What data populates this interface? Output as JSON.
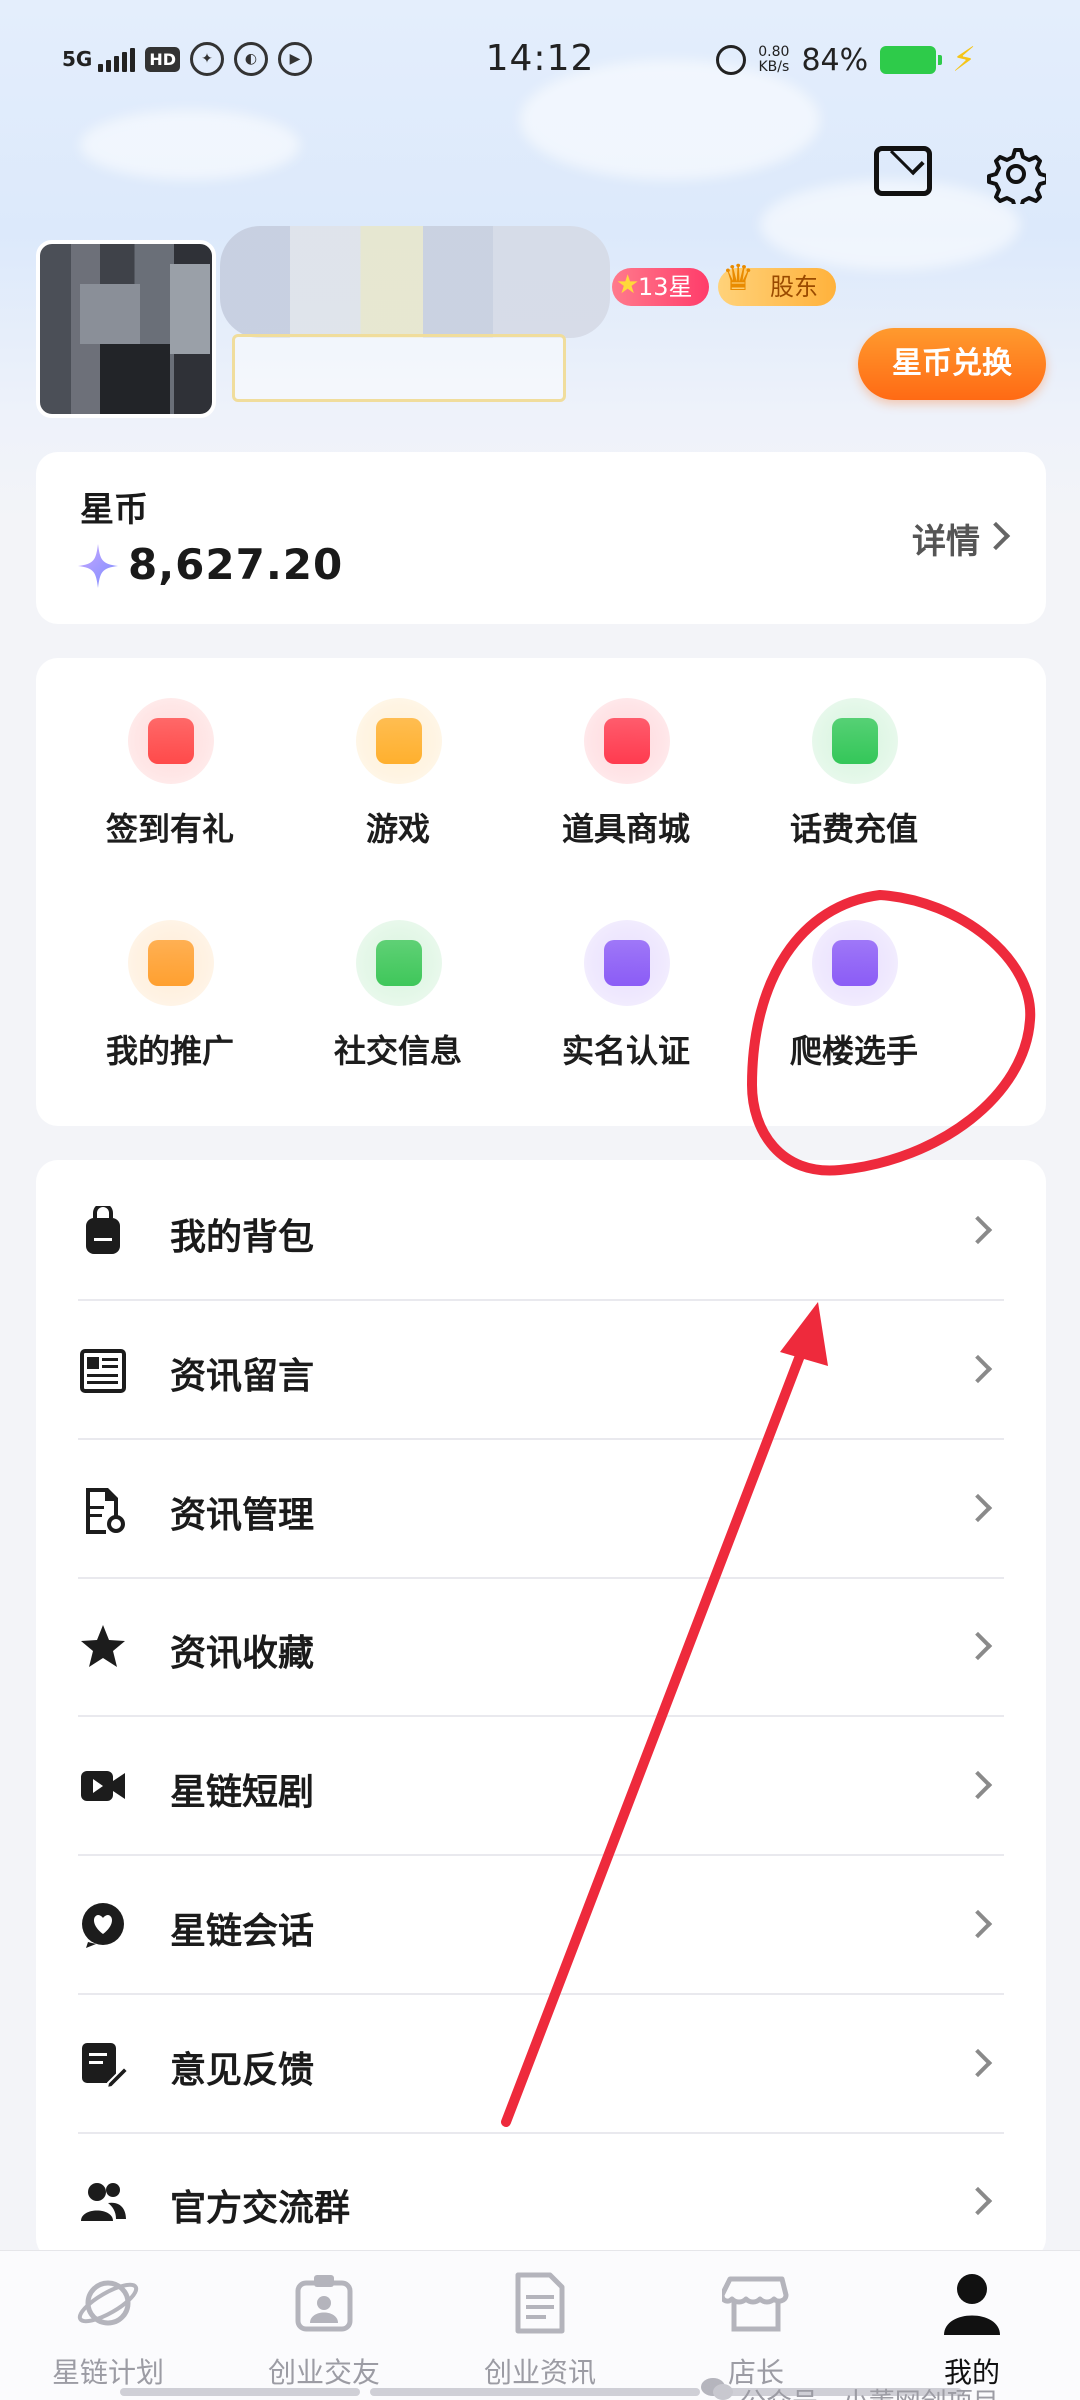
{
  "status_bar": {
    "network": "5G",
    "hd": "HD",
    "time": "14:12",
    "speed_value": "0.80",
    "speed_unit": "KB/s",
    "battery": "84%"
  },
  "profile": {
    "level_badge": "13星",
    "shareholder_badge": "股东",
    "exchange_button": "星币兑换"
  },
  "coins": {
    "label": "星币",
    "value": "8,627.20",
    "detail_link": "详情"
  },
  "quick_actions": [
    {
      "label": "签到有礼",
      "icon": "gift-icon",
      "color": "#ff4a4a"
    },
    {
      "label": "游戏",
      "icon": "gamepad-icon",
      "color": "#ffb02e"
    },
    {
      "label": "道具商城",
      "icon": "shop-icon",
      "color": "#ff3b4f"
    },
    {
      "label": "话费充值",
      "icon": "phone-recharge-icon",
      "color": "#34c759"
    },
    {
      "label": "我的推广",
      "icon": "megaphone-icon",
      "color": "#ffa030"
    },
    {
      "label": "社交信息",
      "icon": "chat-icon",
      "color": "#3fc75a"
    },
    {
      "label": "实名认证",
      "icon": "id-verify-icon",
      "color": "#8b5cf6"
    },
    {
      "label": "爬楼选手",
      "icon": "brick-wall-icon",
      "color": "#8b5cf6"
    }
  ],
  "menu": [
    {
      "label": "我的背包",
      "icon": "backpack-icon"
    },
    {
      "label": "资讯留言",
      "icon": "newspaper-icon"
    },
    {
      "label": "资讯管理",
      "icon": "document-gear-icon"
    },
    {
      "label": "资讯收藏",
      "icon": "star-icon"
    },
    {
      "label": "星链短剧",
      "icon": "video-icon"
    },
    {
      "label": "星链会话",
      "icon": "heart-chat-icon"
    },
    {
      "label": "意见反馈",
      "icon": "feedback-edit-icon"
    },
    {
      "label": "官方交流群",
      "icon": "group-icon"
    }
  ],
  "tabs": [
    {
      "label": "星链计划",
      "icon": "planet-icon",
      "active": false
    },
    {
      "label": "创业交友",
      "icon": "id-card-icon",
      "active": false
    },
    {
      "label": "创业资讯",
      "icon": "document-icon",
      "active": false
    },
    {
      "label": "店长",
      "icon": "store-icon",
      "active": false
    },
    {
      "label": "我的",
      "icon": "person-icon",
      "active": true
    }
  ],
  "watermark": "公众号 · 小董网创项目",
  "colors": {
    "accent_orange": "#ff6a14",
    "annotation_red": "#ee2a3c",
    "background": "#f3f4f8"
  }
}
